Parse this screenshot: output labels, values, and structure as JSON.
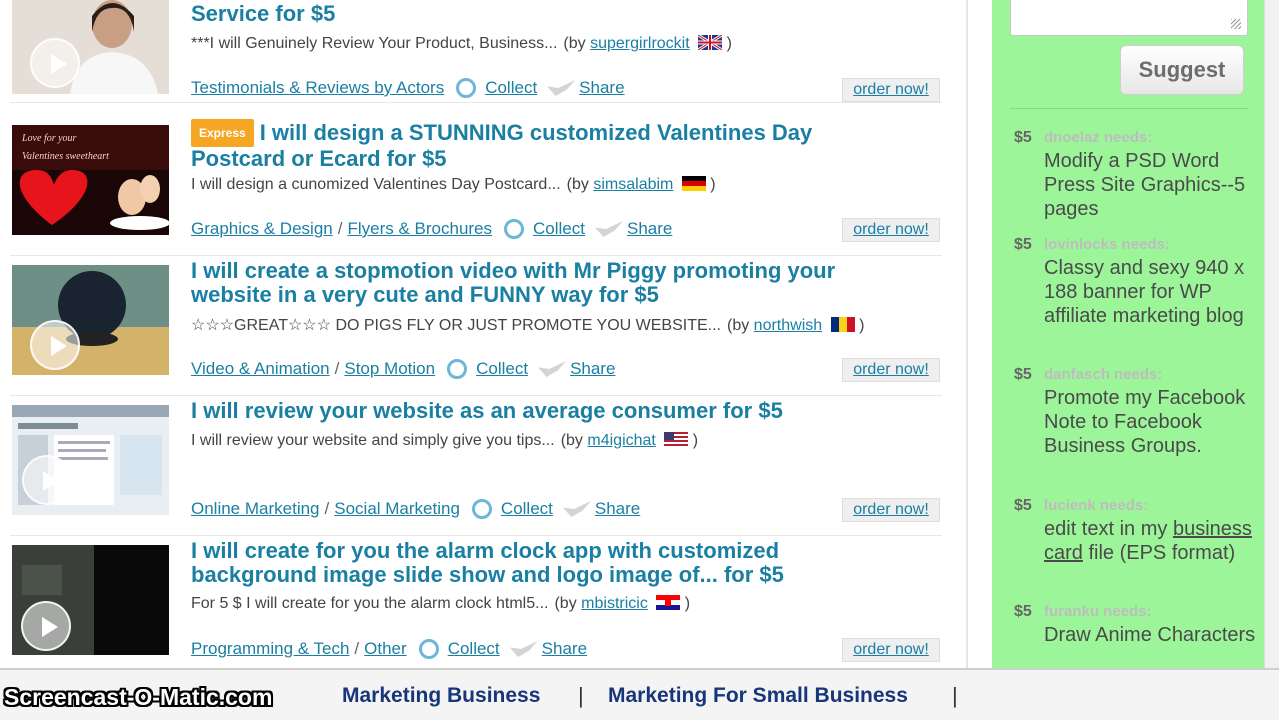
{
  "gigs": [
    {
      "title": "Service for $5",
      "badge": "",
      "description": "***I will Genuinely Review Your Product, Business...",
      "by_prefix": "(by",
      "user": "supergirlrockit",
      "close": ")",
      "flag": "uk-flag-icon",
      "category": "Testimonials & Reviews by Actors",
      "subcategory": "",
      "collect": "Collect",
      "share": "Share",
      "order": "order now!"
    },
    {
      "title": "I will design a STUNNING customized Valentines Day Postcard or Ecard for $5",
      "badge": "Express",
      "description": "I will design a cunomized Valentines Day Postcard...",
      "by_prefix": "(by",
      "user": "simsalabim",
      "close": ")",
      "flag": "germany-flag-icon",
      "category": "Graphics & Design",
      "subcategory": "Flyers & Brochures",
      "collect": "Collect",
      "share": "Share",
      "order": "order now!"
    },
    {
      "title": "I will create a stopmotion video with Mr Piggy promoting your website in a very cute and FUNNY way for $5",
      "badge": "",
      "description": "☆☆☆GREAT☆☆☆ DO PIGS FLY OR JUST PROMOTE YOU WEBSITE...",
      "by_prefix": "(by",
      "user": "northwish",
      "close": ")",
      "flag": "romania-flag-icon",
      "category": "Video & Animation",
      "subcategory": "Stop Motion",
      "collect": "Collect",
      "share": "Share",
      "order": "order now!"
    },
    {
      "title": "I will review your website as an average consumer for $5",
      "badge": "",
      "description": "I will review your website and simply give you tips...",
      "by_prefix": "(by",
      "user": "m4igichat",
      "close": ")",
      "flag": "us-flag-icon",
      "category": "Online Marketing",
      "subcategory": "Social Marketing",
      "collect": "Collect",
      "share": "Share",
      "order": "order now!"
    },
    {
      "title": "I will create for you the alarm clock app with customized background image slide show and logo image of... for $5",
      "badge": "",
      "description": "For 5 $ I will create for you the alarm clock html5...",
      "by_prefix": "(by",
      "user": "mbistricic",
      "close": ")",
      "flag": "croatia-flag-icon",
      "category": "Programming & Tech",
      "subcategory": "Other",
      "collect": "Collect",
      "share": "Share",
      "order": "order now!"
    }
  ],
  "sidebar": {
    "suggest_label": "Suggest",
    "requests": [
      {
        "price": "$5",
        "who": "dnoelaz needs:",
        "text": "Modify a PSD Word Press Site Graphics--5 pages"
      },
      {
        "price": "$5",
        "who": "lovinlocks needs:",
        "text": "Classy and sexy 940 x 188 banner for WP affiliate marketing blog"
      },
      {
        "price": "$5",
        "who": "danfasch needs:",
        "text": "Promote my Facebook Note to Facebook Business Groups."
      },
      {
        "price": "$5",
        "who": "lucienk needs:",
        "text_before": "edit text in my",
        "text_link": "business card",
        "text_after": "file (EPS format)"
      },
      {
        "price": "$5",
        "who": "furanku needs:",
        "text": "Draw Anime Characters"
      }
    ]
  },
  "bottom_bar": {
    "watermark": "Screencast-O-Matic.com",
    "keywords": [
      "Marketing Business",
      "Marketing For Small Business"
    ],
    "separator": "|"
  },
  "colors": {
    "link": "#1a7fa3",
    "sidebar_bg": "#9df59a",
    "express_badge": "#f5a623",
    "keyword_text": "#17367a"
  }
}
